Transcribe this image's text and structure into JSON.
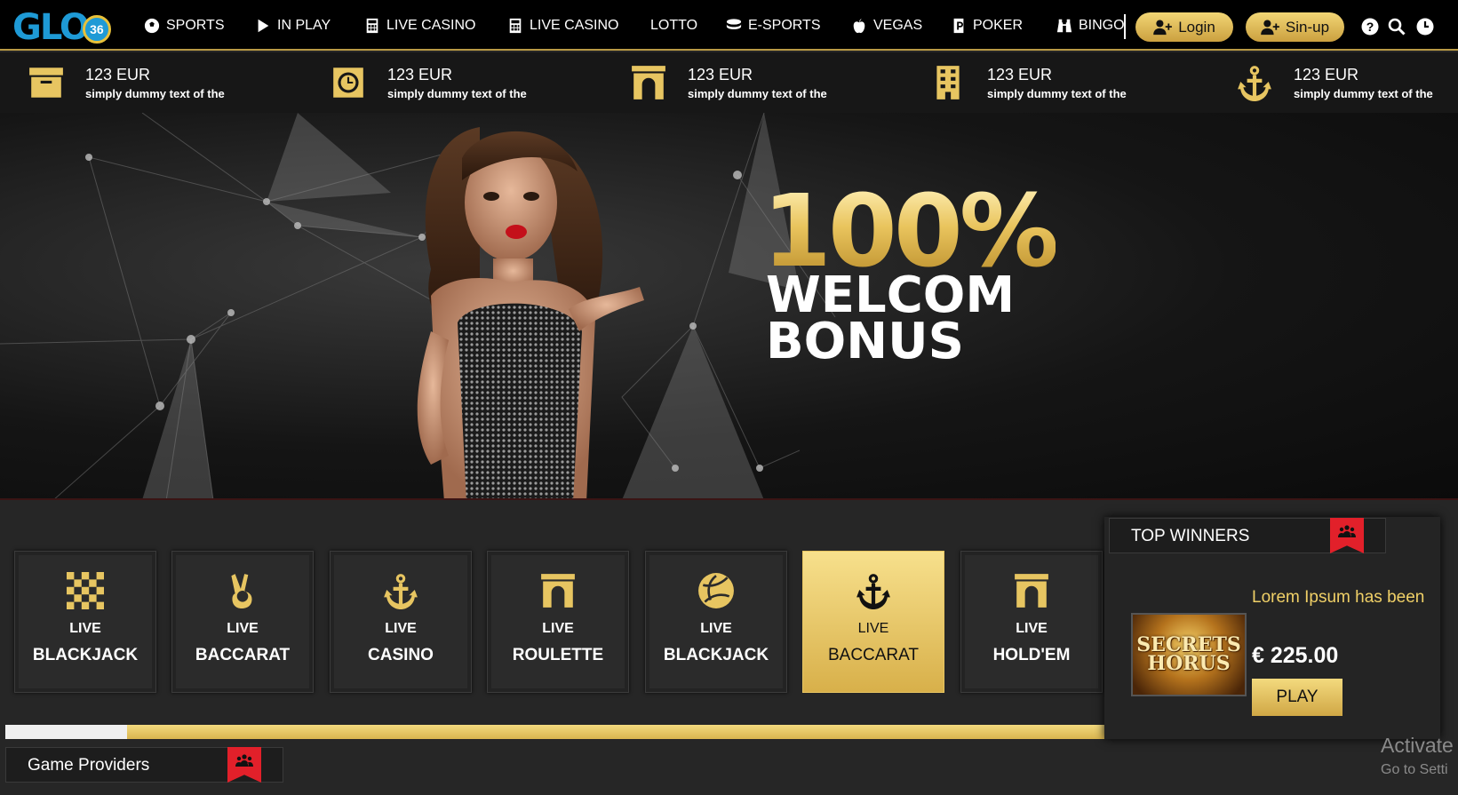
{
  "brand": {
    "logo_text": "GLO",
    "logo_badge": "36",
    "accent": "#e7c561",
    "brand_blue": "#1e9ad6"
  },
  "nav": {
    "items": [
      {
        "label": "SPORTS",
        "icon": "soccer-ball-icon"
      },
      {
        "label": "IN PLAY",
        "icon": "play-icon"
      },
      {
        "label": "LIVE CASINO",
        "icon": "calculator-icon"
      },
      {
        "label": "LIVE CASINO",
        "icon": "calculator-icon"
      },
      {
        "label": "LOTTO",
        "icon": ""
      },
      {
        "label": "E-SPORTS",
        "icon": "database-icon"
      },
      {
        "label": "VEGAS",
        "icon": "apple-icon"
      },
      {
        "label": "POKER",
        "icon": "parking-sign-icon"
      },
      {
        "label": "BINGO",
        "icon": "binoculars-icon"
      }
    ],
    "login_label": "Login",
    "signup_label": "Sin-up",
    "util_icons": [
      "help-icon",
      "search-icon",
      "clock-icon"
    ]
  },
  "stats": [
    {
      "amount": "123 EUR",
      "desc": "simply dummy text of the",
      "icon": "archive-box-icon"
    },
    {
      "amount": "123 EUR",
      "desc": "simply dummy text of the",
      "icon": "stopwatch-icon"
    },
    {
      "amount": "123 EUR",
      "desc": "simply dummy text of the",
      "icon": "arch-icon"
    },
    {
      "amount": "123 EUR",
      "desc": "simply dummy text of the",
      "icon": "building-icon"
    },
    {
      "amount": "123 EUR",
      "desc": "simply dummy text of the",
      "icon": "anchor-icon"
    }
  ],
  "hero": {
    "percent": "100%",
    "line1": "WELCOM",
    "line2": "BONUS"
  },
  "games": [
    {
      "top": "LIVE",
      "name": "BLACKJACK",
      "icon": "checkerboard-icon",
      "active": false
    },
    {
      "top": "LIVE",
      "name": "BACCARAT",
      "icon": "peace-hand-icon",
      "active": false
    },
    {
      "top": "LIVE",
      "name": "CASINO",
      "icon": "anchor-icon",
      "active": false
    },
    {
      "top": "LIVE",
      "name": "ROULETTE",
      "icon": "arch-icon",
      "active": false
    },
    {
      "top": "LIVE",
      "name": "BLACKJACK",
      "icon": "volleyball-icon",
      "active": false
    },
    {
      "top": "LIVE",
      "name": "BACCARAT",
      "icon": "anchor-icon",
      "active": true
    },
    {
      "top": "LIVE",
      "name": "HOLD'EM",
      "icon": "arch-icon",
      "active": false
    }
  ],
  "scroll": {
    "position_fraction": 0.11
  },
  "top_winners": {
    "heading": "TOP WINNERS",
    "game_thumb_text": "SECRETS HORUS",
    "title": "Lorem Ipsum has been",
    "amount": "€ 225.00",
    "play_label": "PLAY"
  },
  "providers": {
    "heading": "Game Providers"
  },
  "watermark": {
    "line1": "Activate",
    "line2": "Go to Setti"
  }
}
